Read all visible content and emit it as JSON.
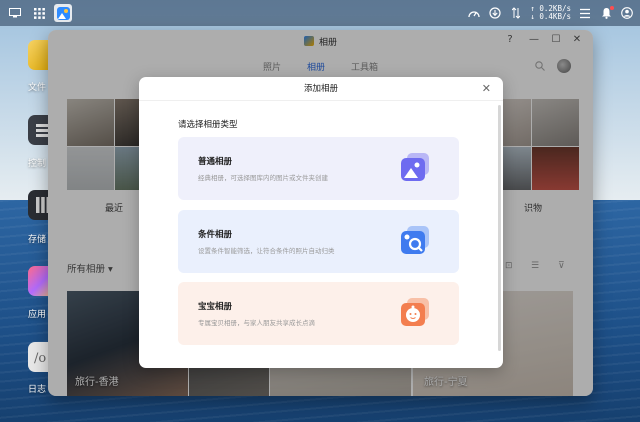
{
  "taskbar": {
    "net_up": "↑ 0.2KB/s",
    "net_down": "↓ 0.4KB/s"
  },
  "desktop": {
    "items": [
      {
        "label": "文件"
      },
      {
        "label": "控制"
      },
      {
        "label": "存储"
      },
      {
        "label": "应用"
      },
      {
        "label": "日志"
      }
    ]
  },
  "window": {
    "title": "相册",
    "tabs": [
      {
        "label": "照片"
      },
      {
        "label": "相册"
      },
      {
        "label": "工具箱"
      }
    ],
    "recent_label": "最近",
    "objects_label": "识物",
    "all_albums_label": "所有相册 ▾",
    "album_covers": [
      {
        "label": "旅行-香港"
      },
      {
        "label": "旅行-宁夏"
      }
    ],
    "controls": {
      "help": "?",
      "minimize": "—",
      "maximize": "☐",
      "close": "✕"
    }
  },
  "dialog": {
    "title": "添加相册",
    "heading": "请选择相册类型",
    "close": "✕",
    "cards": [
      {
        "title": "普通相册",
        "desc": "经典相册，可选择图库内的图片或文件夹创建",
        "bg": "#eff0fb",
        "accent": "#6e6bf0"
      },
      {
        "title": "条件相册",
        "desc": "设置条件智能筛选，让符合条件的照片自动归类",
        "bg": "#eaf0fd",
        "accent": "#3f7bef"
      },
      {
        "title": "宝宝相册",
        "desc": "专属宝贝相册，与家人朋友共享成长点滴",
        "bg": "#fdf0ea",
        "accent": "#f37e4f"
      }
    ]
  }
}
